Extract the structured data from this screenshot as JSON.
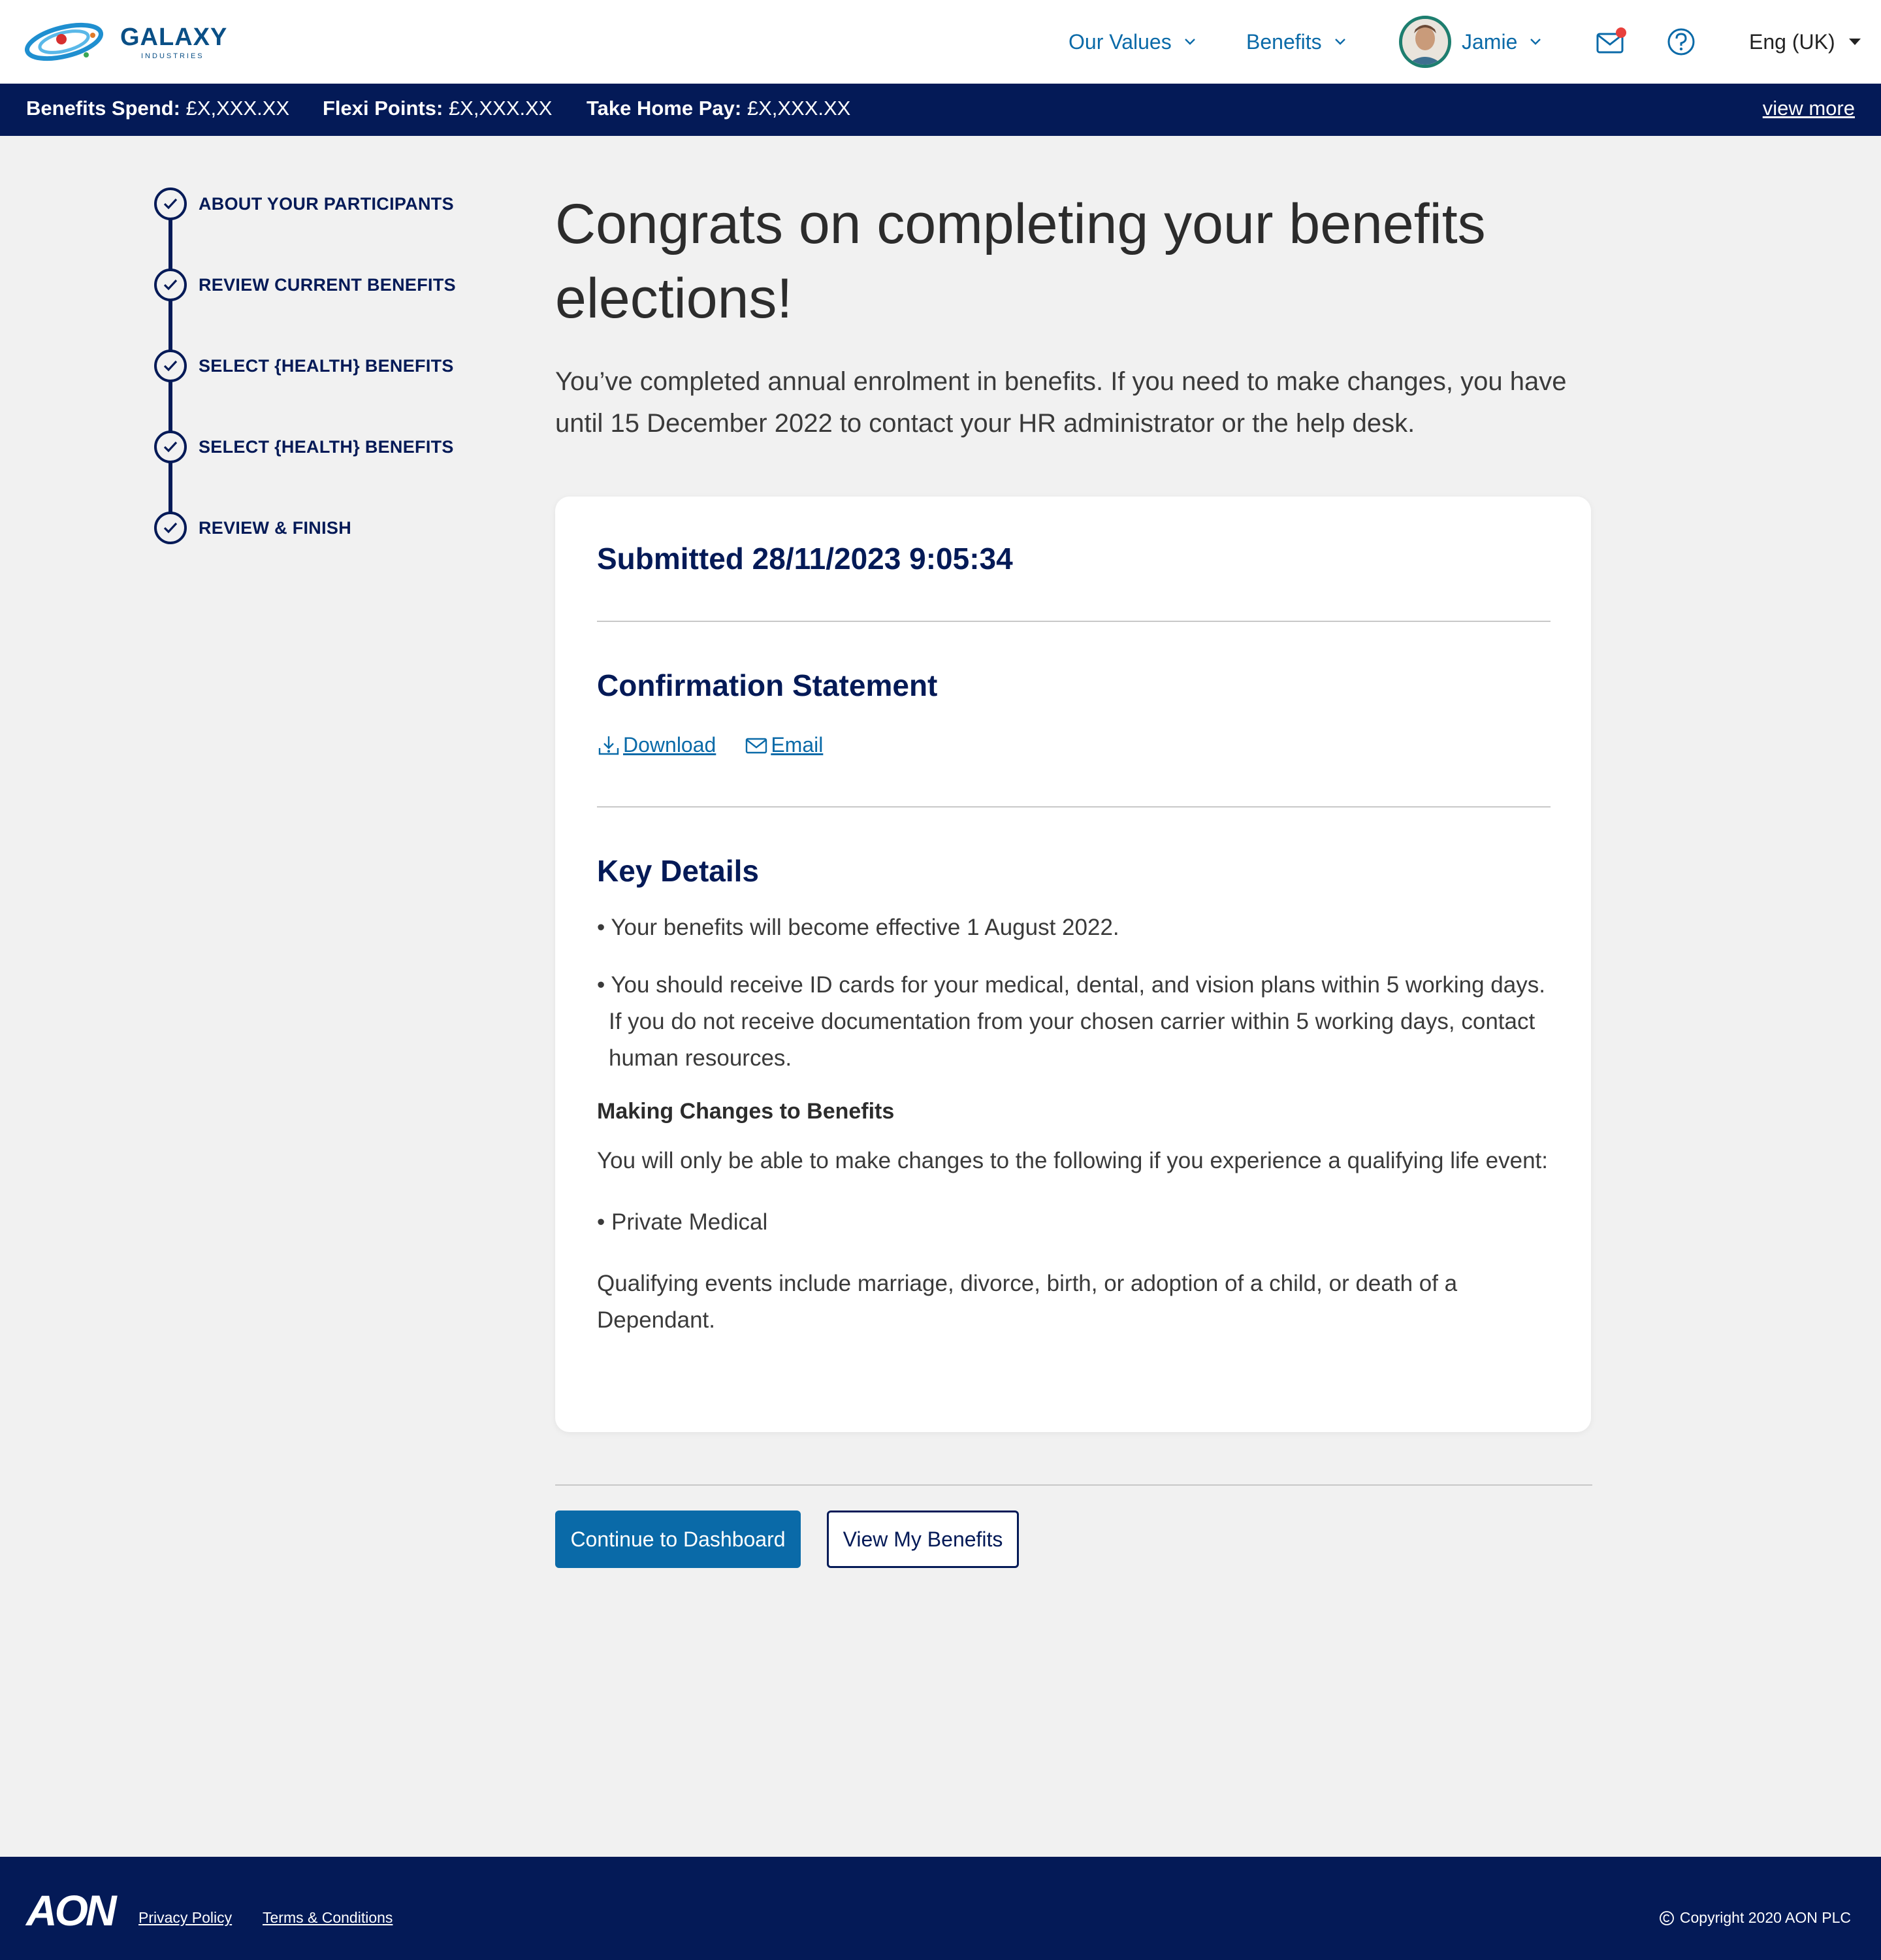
{
  "header": {
    "logo_text": "GALAXY",
    "logo_subtext": "INDUSTRIES",
    "nav": [
      {
        "label": "Our Values"
      },
      {
        "label": "Benefits"
      }
    ],
    "user_name": "Jamie",
    "language": "Eng (UK)"
  },
  "stats_bar": {
    "benefits_spend_label": "Benefits Spend:",
    "benefits_spend_value": "£X,XXX.XX",
    "flexi_points_label": "Flexi Points:",
    "flexi_points_value": "£X,XXX.XX",
    "take_home_label": "Take Home Pay:",
    "take_home_value": "£X,XXX.XX",
    "view_more": "view more"
  },
  "stepper": {
    "steps": [
      {
        "label": "ABOUT YOUR PARTICIPANTS",
        "status": "complete"
      },
      {
        "label": "REVIEW CURRENT BENEFITS",
        "status": "complete"
      },
      {
        "label": "SELECT {HEALTH} BENEFITS",
        "status": "complete"
      },
      {
        "label": "SELECT {HEALTH} BENEFITS",
        "status": "complete"
      },
      {
        "label": "REVIEW & FINISH",
        "status": "complete"
      }
    ]
  },
  "main": {
    "title": "Congrats on completing your benefits elections!",
    "subtitle": "You’ve completed annual enrolment in benefits. If you need to make changes, you have until 15 December 2022 to contact your HR administrator or the help desk.",
    "card": {
      "submitted": "Submitted 28/11/2023 9:05:34",
      "confirmation_heading": "Confirmation Statement",
      "download_label": "Download",
      "email_label": "Email",
      "key_details_heading": "Key Details",
      "key_details": [
        "• Your benefits will become effective 1 August 2022.",
        "• You should receive ID cards for your medical, dental, and vision plans within 5 working days. If you do not receive documentation from your chosen carrier within 5 working days, contact human resources."
      ],
      "changes_heading": "Making Changes to Benefits",
      "changes_intro": "You will only be able to make changes to the following if you experience a qualifying life event:",
      "changes_items": [
        "• Private Medical"
      ],
      "qualifying_events": "Qualifying events include marriage, divorce, birth, or adoption of a child, or death of a Dependant."
    },
    "buttons": {
      "continue": "Continue to Dashboard",
      "view_benefits": "View My Benefits"
    }
  },
  "footer": {
    "brand": "AON",
    "privacy": "Privacy Policy",
    "terms": "Terms & Conditions",
    "copyright": "Copyright 2020 AON PLC"
  },
  "colors": {
    "navy": "#041a57",
    "link_blue": "#0a6aa8",
    "page_bg": "#f1f1f1",
    "notification_dot": "#e8403c"
  }
}
